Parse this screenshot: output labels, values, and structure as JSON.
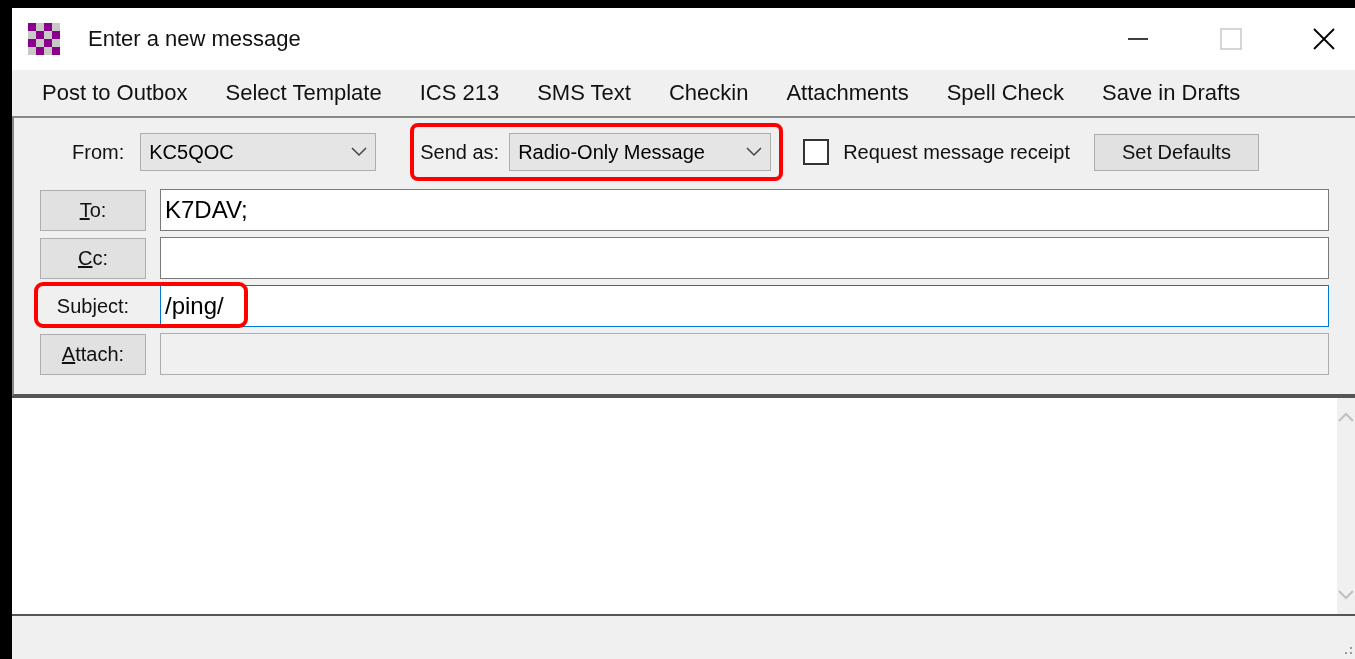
{
  "window": {
    "title": "Enter a new message",
    "maximize_disabled": true
  },
  "menu": [
    "Post to Outbox",
    "Select Template",
    "ICS 213",
    "SMS Text",
    "Checkin",
    "Attachments",
    "Spell Check",
    "Save in Drafts"
  ],
  "from": {
    "label": "From:",
    "value": "KC5QOC"
  },
  "send_as": {
    "label": "Send as:",
    "value": "Radio-Only Message",
    "highlighted": true
  },
  "request_receipt": {
    "label": "Request message receipt",
    "checked": false
  },
  "set_defaults": "Set Defaults",
  "fields": [
    {
      "kind": "button",
      "label": "To:",
      "value": "K7DAV;",
      "focused": false,
      "disabled": false,
      "highlighted": false
    },
    {
      "kind": "button",
      "label": "Cc:",
      "focused": false,
      "disabled": false,
      "highlighted": false
    },
    {
      "kind": "label",
      "label": "Subject:",
      "value": "/ping/",
      "focused": true,
      "disabled": false,
      "highlighted": true
    },
    {
      "kind": "button",
      "label": "Attach:",
      "focused": false,
      "disabled": true,
      "highlighted": false
    }
  ]
}
